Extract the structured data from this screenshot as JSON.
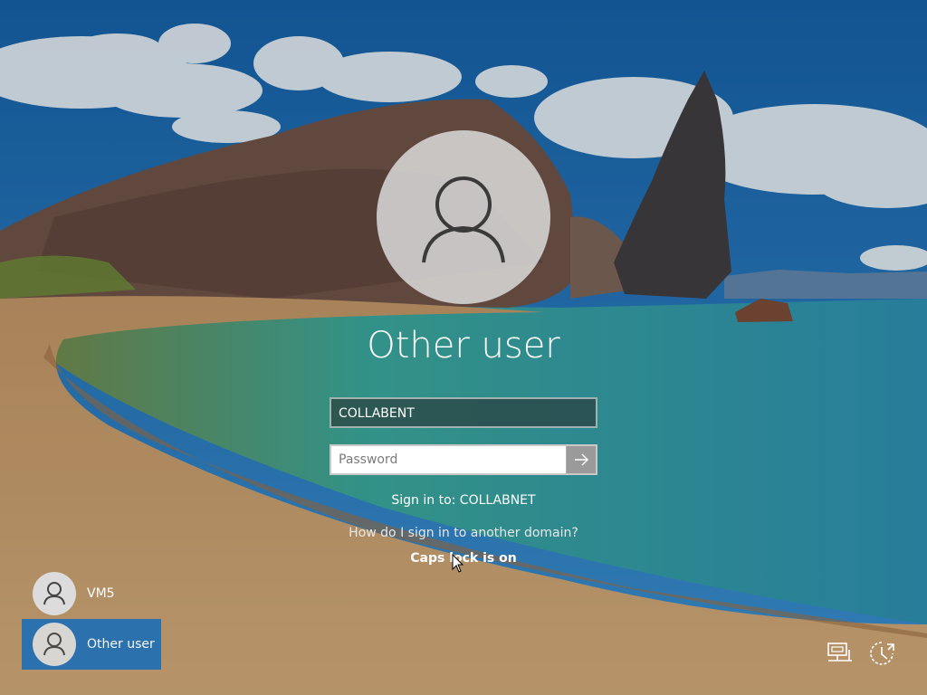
{
  "colors": {
    "sky": "#1b6fb3",
    "sand": "#c7a06b",
    "sea": "#2aa5a0",
    "selected_tile": "#1f6fb4"
  },
  "login": {
    "avatar_icon": "user-silhouette-icon",
    "title": "Other user",
    "username_value": "COLLABENT",
    "password_placeholder": "Password",
    "submit_icon": "arrow-right-icon",
    "sign_in_to": "Sign in to: COLLABNET",
    "domain_link": "How do I sign in to another domain?",
    "caps_lock": "Caps lock is on"
  },
  "users": [
    {
      "label": "VM5",
      "icon": "user-icon",
      "selected": false
    },
    {
      "label": "Other user",
      "icon": "user-icon",
      "selected": true
    }
  ],
  "tray": {
    "network_icon": "network-icon",
    "accessibility_icon": "ease-of-access-icon"
  }
}
